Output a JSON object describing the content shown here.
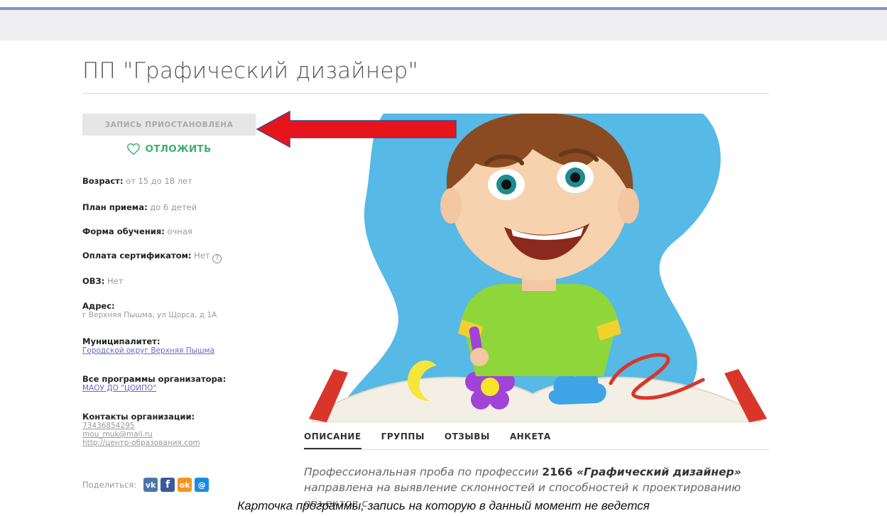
{
  "page": {
    "title": "ПП \"Графический дизайнер\""
  },
  "sidebar": {
    "status_button": "ЗАПИСЬ ПРИОСТАНОВЛЕНА",
    "postpone_label": "ОТЛОЖИТЬ",
    "age_label": "Возраст:",
    "age_value": "от 15 до 18 лет",
    "plan_label": "План приема:",
    "plan_value": "до 6 детей",
    "form_label": "Форма обучения:",
    "form_value": "очная",
    "payment_label": "Оплата сертификатом:",
    "payment_value": "Нет",
    "payment_help": "?",
    "ovz_label": "ОВЗ:",
    "ovz_value": "Нет",
    "address_label": "Адрес:",
    "address_value": "г Верхняя Пышма, ул Щорса, д 1А",
    "municipality_label": "Муниципалитет:",
    "municipality_link": "Городской округ Верхняя Пышма",
    "organizer_label": "Все программы организатора:",
    "organizer_link": "МАОУ ДО \"ЦОИПО\"",
    "contacts_label": "Контакты организации:",
    "contact_phone": "73436854295",
    "contact_email": "mou_muk@mail.ru",
    "contact_site": "http://центр-образования.com",
    "share_label": "Поделиться:",
    "share_icons": [
      "vk-icon",
      "facebook-icon",
      "odnoklassniki-icon",
      "mailru-icon"
    ],
    "share_glyphs": {
      "vk": "vk",
      "fb": "f",
      "ok": "ok",
      "mm": "@"
    }
  },
  "tabs": [
    "ОПИСАНИЕ",
    "ГРУППЫ",
    "ОТЗЫВЫ",
    "АНКЕТА"
  ],
  "description": {
    "part1": "Профессиональная проба по профессии ",
    "code": "2166",
    "name": "«Графический дизайнер»",
    "part2": " направлена на выявление склонностей и способностей к проектированию объектов с"
  },
  "caption": "Карточка программы, запись на которую в данный момент не ведется",
  "colors": {
    "accent_green": "#3bb36b",
    "link": "#6868c8",
    "arrow": "#e8141c",
    "top_border": "#8b8ec8"
  }
}
